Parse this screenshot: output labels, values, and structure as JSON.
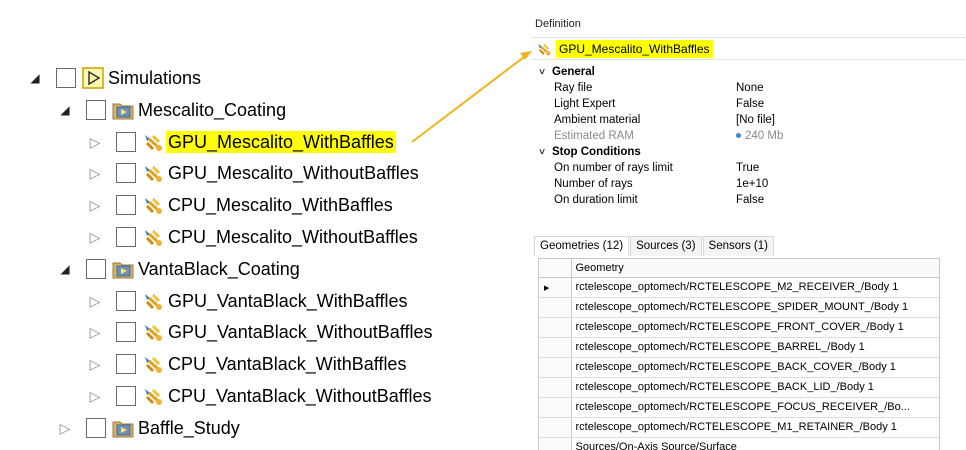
{
  "tree": {
    "root": {
      "label": "Simulations"
    },
    "groups": [
      {
        "label": "Mescalito_Coating",
        "items": [
          {
            "label": "GPU_Mescalito_WithBaffles",
            "selected": true
          },
          {
            "label": "GPU_Mescalito_WithoutBaffles"
          },
          {
            "label": "CPU_Mescalito_WithBaffles"
          },
          {
            "label": "CPU_Mescalito_WithoutBaffles"
          }
        ]
      },
      {
        "label": "VantaBlack_Coating",
        "items": [
          {
            "label": "GPU_VantaBlack_WithBaffles"
          },
          {
            "label": "GPU_VantaBlack_WithoutBaffles"
          },
          {
            "label": "CPU_VantaBlack_WithBaffles"
          },
          {
            "label": "CPU_VantaBlack_WithoutBaffles"
          }
        ]
      },
      {
        "label": "Baffle_Study"
      }
    ]
  },
  "definition": {
    "title": "Definition",
    "selected_name": "GPU_Mescalito_WithBaffles",
    "categories": [
      {
        "name": "General",
        "props": [
          {
            "name": "Ray file",
            "value": "None"
          },
          {
            "name": "Light Expert",
            "value": "False"
          },
          {
            "name": "Ambient material",
            "value": "[No file]"
          },
          {
            "name": "Estimated RAM",
            "value": "240 Mb"
          }
        ]
      },
      {
        "name": "Stop Conditions",
        "props": [
          {
            "name": "On number of rays limit",
            "value": "True"
          },
          {
            "name": "Number of rays",
            "value": "1e+10"
          },
          {
            "name": "On duration limit",
            "value": "False"
          }
        ]
      }
    ]
  },
  "tabs": [
    "Geometries (12)",
    "Sources (3)",
    "Sensors (1)"
  ],
  "geometry_table": {
    "header": "Geometry",
    "rows": [
      "rctelescope_optomech/RCTELESCOPE_M2_RECEIVER_/Body 1",
      "rctelescope_optomech/RCTELESCOPE_SPIDER_MOUNT_/Body 1",
      "rctelescope_optomech/RCTELESCOPE_FRONT_COVER_/Body 1",
      "rctelescope_optomech/RCTELESCOPE_BARREL_/Body 1",
      "rctelescope_optomech/RCTELESCOPE_BACK_COVER_/Body 1",
      "rctelescope_optomech/RCTELESCOPE_BACK_LID_/Body 1",
      "rctelescope_optomech/RCTELESCOPE_FOCUS_RECEIVER_/Bo...",
      "rctelescope_optomech/RCTELESCOPE_M1_RETAINER_/Body 1",
      "Sources/On-Axis Source/Surface"
    ]
  },
  "colors": {
    "highlight": "#ffff00",
    "arrow": "#f2b21b",
    "folder": "#c8a060"
  },
  "icons": {
    "root": "simulation-root-icon",
    "group": "folder-simulation-icon",
    "simulation": "simulation-icon"
  }
}
